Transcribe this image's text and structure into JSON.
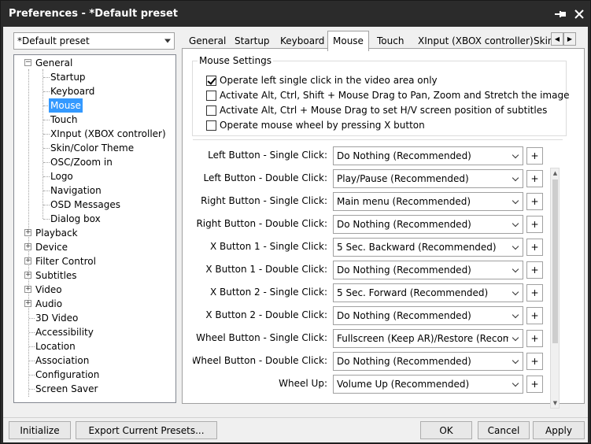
{
  "window": {
    "title": "Preferences - *Default preset"
  },
  "preset": {
    "value": "*Default preset"
  },
  "tree": {
    "items": [
      {
        "label": "General"
      },
      {
        "label": "Startup"
      },
      {
        "label": "Keyboard"
      },
      {
        "label": "Mouse"
      },
      {
        "label": "Touch"
      },
      {
        "label": "XInput (XBOX controller)"
      },
      {
        "label": "Skin/Color Theme"
      },
      {
        "label": "OSC/Zoom in"
      },
      {
        "label": "Logo"
      },
      {
        "label": "Navigation"
      },
      {
        "label": "OSD Messages"
      },
      {
        "label": "Dialog box"
      },
      {
        "label": "Playback"
      },
      {
        "label": "Device"
      },
      {
        "label": "Filter Control"
      },
      {
        "label": "Subtitles"
      },
      {
        "label": "Video"
      },
      {
        "label": "Audio"
      },
      {
        "label": "3D Video"
      },
      {
        "label": "Accessibility"
      },
      {
        "label": "Location"
      },
      {
        "label": "Association"
      },
      {
        "label": "Configuration"
      },
      {
        "label": "Screen Saver"
      }
    ]
  },
  "tabs": [
    "General",
    "Startup",
    "Keyboard",
    "Mouse",
    "Touch",
    "XInput (XBOX controller)",
    "Skin"
  ],
  "group": {
    "title": "Mouse Settings",
    "checks": [
      {
        "label": "Operate left single click in the video area only",
        "checked": true
      },
      {
        "label": "Activate Alt, Ctrl, Shift + Mouse Drag to Pan, Zoom and Stretch the image",
        "checked": false
      },
      {
        "label": "Activate Alt, Ctrl + Mouse Drag to set H/V screen position of subtitles",
        "checked": false
      },
      {
        "label": "Operate mouse wheel by pressing X button",
        "checked": false
      }
    ]
  },
  "bindings": [
    {
      "label": "Left Button - Single Click:",
      "value": "Do Nothing (Recommended)"
    },
    {
      "label": "Left Button - Double Click:",
      "value": "Play/Pause (Recommended)"
    },
    {
      "label": "Right Button - Single Click:",
      "value": "Main menu (Recommended)"
    },
    {
      "label": "Right Button - Double Click:",
      "value": "Do Nothing (Recommended)"
    },
    {
      "label": "X Button 1 - Single Click:",
      "value": "5 Sec. Backward (Recommended)"
    },
    {
      "label": "X Button 1 - Double Click:",
      "value": "Do Nothing (Recommended)"
    },
    {
      "label": "X Button 2 - Single Click:",
      "value": "5 Sec. Forward (Recommended)"
    },
    {
      "label": "X Button 2 - Double Click:",
      "value": "Do Nothing (Recommended)"
    },
    {
      "label": "Wheel Button - Single Click:",
      "value": "Fullscreen (Keep AR)/Restore (Recommended)"
    },
    {
      "label": "Wheel Button - Double Click:",
      "value": "Do Nothing (Recommended)"
    },
    {
      "label": "Wheel Up:",
      "value": "Volume Up (Recommended)"
    }
  ],
  "plus_label": "+",
  "footer": {
    "initialize": "Initialize",
    "export": "Export Current Presets...",
    "ok": "OK",
    "cancel": "Cancel",
    "apply": "Apply"
  }
}
